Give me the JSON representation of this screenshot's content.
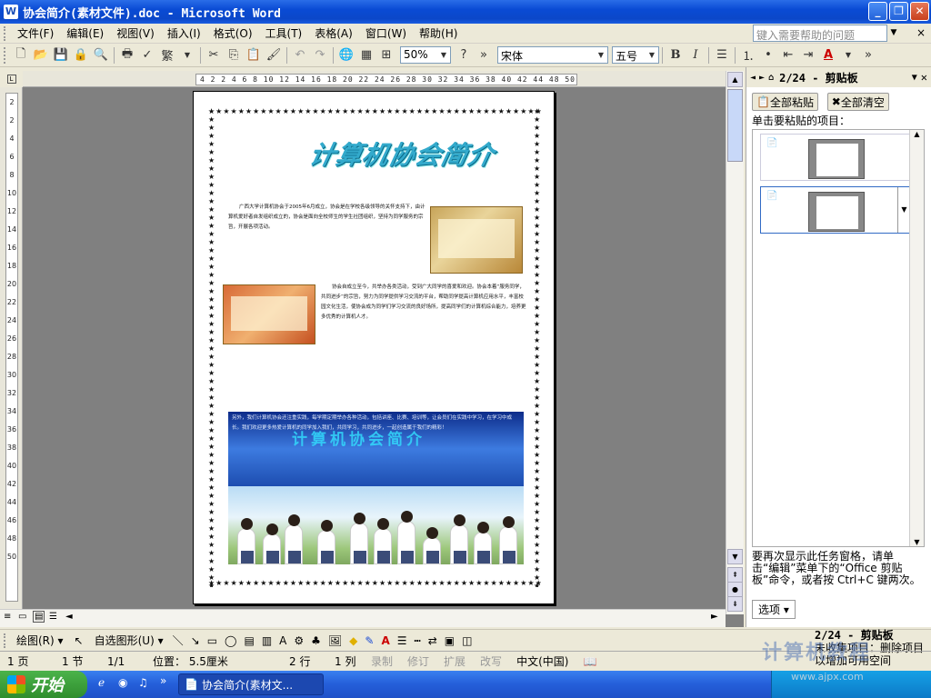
{
  "window": {
    "title": "协会简介(素材文件).doc - Microsoft Word",
    "app_icon": "W"
  },
  "menu": {
    "items": [
      "文件(F)",
      "编辑(E)",
      "视图(V)",
      "插入(I)",
      "格式(O)",
      "工具(T)",
      "表格(A)",
      "窗口(W)",
      "帮助(H)"
    ],
    "help_placeholder": "键入需要帮助的问题",
    "close": "×"
  },
  "toolbar": {
    "zoom": "50%",
    "font": "宋体",
    "font_size": "五号",
    "bold": "B",
    "italic": "I",
    "font_color_letter": "A",
    "font_color": "#cc0000",
    "chevron": "»"
  },
  "ruler": {
    "horizontal": "4 2 2 4 6 8 10 12 14 16 18 20 22 24 26 28 30 32 34 36 38 40 42 44 48 50",
    "vertical": [
      "2",
      "2",
      "4",
      "6",
      "8",
      "10",
      "12",
      "14",
      "16",
      "18",
      "20",
      "22",
      "24",
      "26",
      "28",
      "30",
      "32",
      "34",
      "36",
      "38",
      "40",
      "42",
      "44",
      "46",
      "48",
      "50"
    ],
    "corner": "L"
  },
  "document": {
    "heading": "计算机协会简介",
    "para1": "广西大学计算机协会于2005年6月成立，协会是在学校各级领导的关怀支持下，由计算机爱好者自发组织成立的，协会是面向全校师生的学生社团组织，坚持为同学服务的宗旨，开展各项活动。",
    "para2": "协会自成立至今，共举办各类活动，受到广大同学的喜爱和欢迎。协会本着“服务同学，共同进步”的宗旨，努力为同学提供学习交流的平台，帮助同学提高计算机应用水平，丰富校园文化生活，使协会成为同学们学习交流的良好场所，提高同学们的计算机综合能力，培养更多优秀的计算机人才。",
    "para3": "另外，我们计算机协会还注重实践，每学期定期举办各种活动，包括讲座、比赛、培训等，让会员们在实践中学习，在学习中成长。我们欢迎更多热爱计算机的同学加入我们，共同学习，共同进步，一起创造属于我们的精彩！",
    "blue_watermark": "计算机协会简介"
  },
  "taskpane": {
    "header": "2/24 - 剪贴板",
    "paste_all": "全部粘贴",
    "clear_all": "全部清空",
    "instruction": "单击要粘贴的项目：",
    "footer": "要再次显示此任务窗格，请单击“编辑”菜单下的“Office 剪贴板”命令，或者按 Ctrl+C 键两次。",
    "options": "选项 ▾"
  },
  "drawbar": {
    "draw": "绘图(R) ▾",
    "autoshapes": "自选图形(U) ▾"
  },
  "pane_status": {
    "title": "2/24 - 剪贴板",
    "line2": "未收集项目：删除项目",
    "line3": "以增加可用空间"
  },
  "status": {
    "page": "1 页",
    "section": "1 节",
    "pages": "1/1",
    "position": "位置： 5.5厘米",
    "line": "2 行",
    "col": "1 列",
    "rec": "录制",
    "trk": "修订",
    "ext": "扩展",
    "ovr": "改写",
    "lang": "中文(中国)"
  },
  "taskbar": {
    "start": "开始",
    "item": "协会简介(素材文...",
    "chevron": "»"
  },
  "watermark": {
    "text": "计算机教程",
    "url": "www.ajpx.com"
  }
}
